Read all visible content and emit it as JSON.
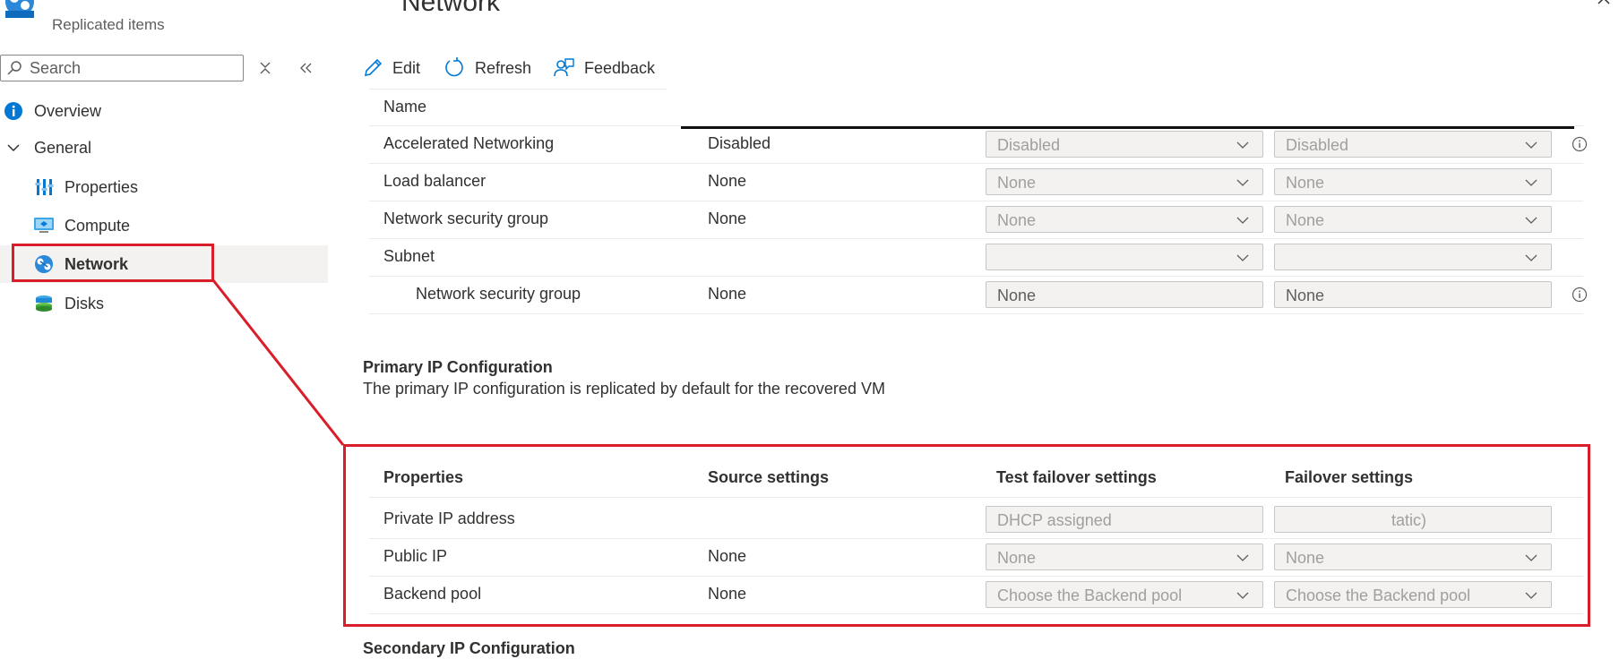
{
  "blade": {
    "title": "Network",
    "subtitle": "Replicated items"
  },
  "sidebar": {
    "search_placeholder": "Search",
    "items": [
      {
        "label": "Overview"
      },
      {
        "label": "General"
      },
      {
        "label": "Properties"
      },
      {
        "label": "Compute"
      },
      {
        "label": "Network"
      },
      {
        "label": "Disks"
      }
    ]
  },
  "toolbar": {
    "edit": "Edit",
    "refresh": "Refresh",
    "feedback": "Feedback"
  },
  "network_table": {
    "name_label": "Name",
    "rows": [
      {
        "label": "Accelerated Networking",
        "source": "Disabled",
        "test": "Disabled",
        "failover": "Disabled"
      },
      {
        "label": "Load balancer",
        "source": "None",
        "test": "None",
        "failover": "None"
      },
      {
        "label": "Network security group",
        "source": "None",
        "test": "None",
        "failover": "None"
      },
      {
        "label": "Subnet",
        "source": "",
        "test": "",
        "failover": ""
      },
      {
        "label": "Network security group",
        "source": "None",
        "test": "None",
        "failover": "None"
      }
    ]
  },
  "primary_ip": {
    "heading": "Primary IP Configuration",
    "description": "The primary IP configuration is replicated by default for the recovered VM",
    "headers": {
      "properties": "Properties",
      "source": "Source settings",
      "test": "Test failover settings",
      "failover": "Failover settings"
    },
    "rows": [
      {
        "label": "Private IP address",
        "source": "",
        "test": "DHCP assigned",
        "failover": "tatic)"
      },
      {
        "label": "Public IP",
        "source": "None",
        "test": "None",
        "failover": "None"
      },
      {
        "label": "Backend pool",
        "source": "None",
        "test": "Choose the Backend pool",
        "failover": "Choose the Backend pool"
      }
    ]
  },
  "secondary_ip": {
    "heading": "Secondary IP Configuration"
  },
  "colors": {
    "highlight_red": "#d91e2a",
    "info_blue": "#0078d4"
  }
}
